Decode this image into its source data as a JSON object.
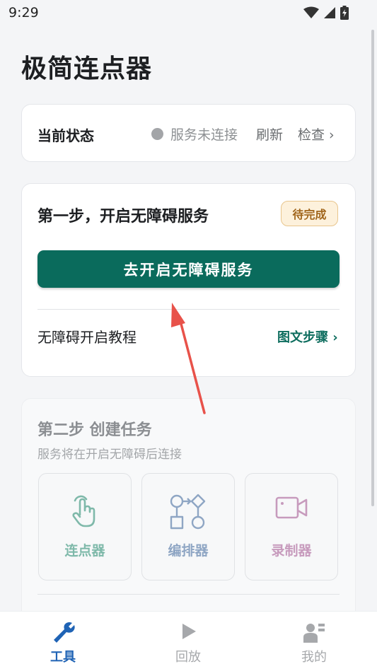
{
  "status_bar": {
    "time": "9:29"
  },
  "app": {
    "title": "极简连点器"
  },
  "status_card": {
    "label": "当前状态",
    "status_text": "服务未连接",
    "refresh": "刷新",
    "check": "检查 ›"
  },
  "step1": {
    "title": "第一步，开启无障碍服务",
    "badge": "待完成",
    "button": "去开启无障碍服务",
    "tutorial_label": "无障碍开启教程",
    "tutorial_link": "图文步骤 ›"
  },
  "step2": {
    "title": "第二步 创建任务",
    "subtitle": "服务将在开启无障碍后连接",
    "tools": [
      {
        "label": "连点器",
        "icon": "tap-hand-icon",
        "color": "#7fb9aa"
      },
      {
        "label": "编排器",
        "icon": "flow-diagram-icon",
        "color": "#8fa6c4"
      },
      {
        "label": "录制器",
        "icon": "video-camera-icon",
        "color": "#c79bbd"
      }
    ]
  },
  "bottom_nav": [
    {
      "label": "工具",
      "icon": "wrench-icon",
      "active": true
    },
    {
      "label": "回放",
      "icon": "play-icon",
      "active": false
    },
    {
      "label": "我的",
      "icon": "profile-icon",
      "active": false
    }
  ],
  "colors": {
    "primary": "#0a6b5c",
    "badge_bg": "#fdf1dc",
    "badge_text": "#a1661c",
    "arrow": "#e8524a",
    "nav_active": "#1f63b5",
    "nav_inactive": "#a6a8ab"
  }
}
